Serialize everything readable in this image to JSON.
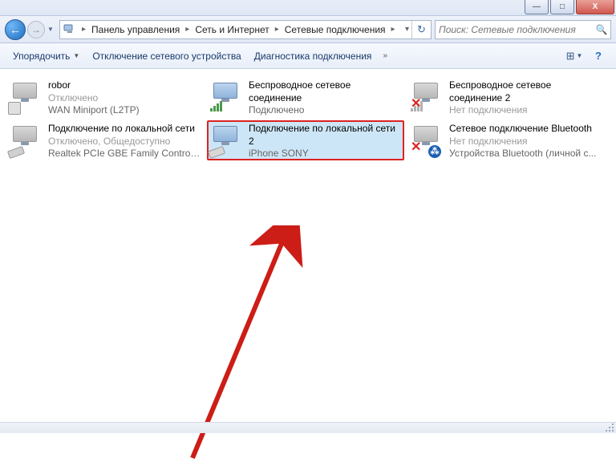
{
  "window": {
    "min": "—",
    "max": "□",
    "close": "X"
  },
  "breadcrumb": {
    "seg1": "Панель управления",
    "seg2": "Сеть и Интернет",
    "seg3": "Сетевые подключения"
  },
  "search": {
    "placeholder": "Поиск: Сетевые подключения"
  },
  "toolbar": {
    "organize": "Упорядочить",
    "disable": "Отключение сетевого устройства",
    "diagnose": "Диагностика подключения"
  },
  "connections": [
    {
      "name": "robor",
      "status": "Отключено",
      "device": "WAN Miniport (L2TP)"
    },
    {
      "name": "Беспроводное сетевое соединение",
      "status": "Подключено",
      "device": ""
    },
    {
      "name": "Беспроводное сетевое соединение 2",
      "status": "Нет подключения",
      "device": ""
    },
    {
      "name": "Подключение по локальной сети",
      "status": "Отключено, Общедоступно",
      "device": "Realtek PCIe GBE Family Controller"
    },
    {
      "name": "Подключение по локальной сети 2",
      "status": "",
      "device": "iPhone SONY"
    },
    {
      "name": "Сетевое подключение Bluetooth",
      "status": "Нет подключения",
      "device": "Устройства Bluetooth (личной с..."
    }
  ]
}
